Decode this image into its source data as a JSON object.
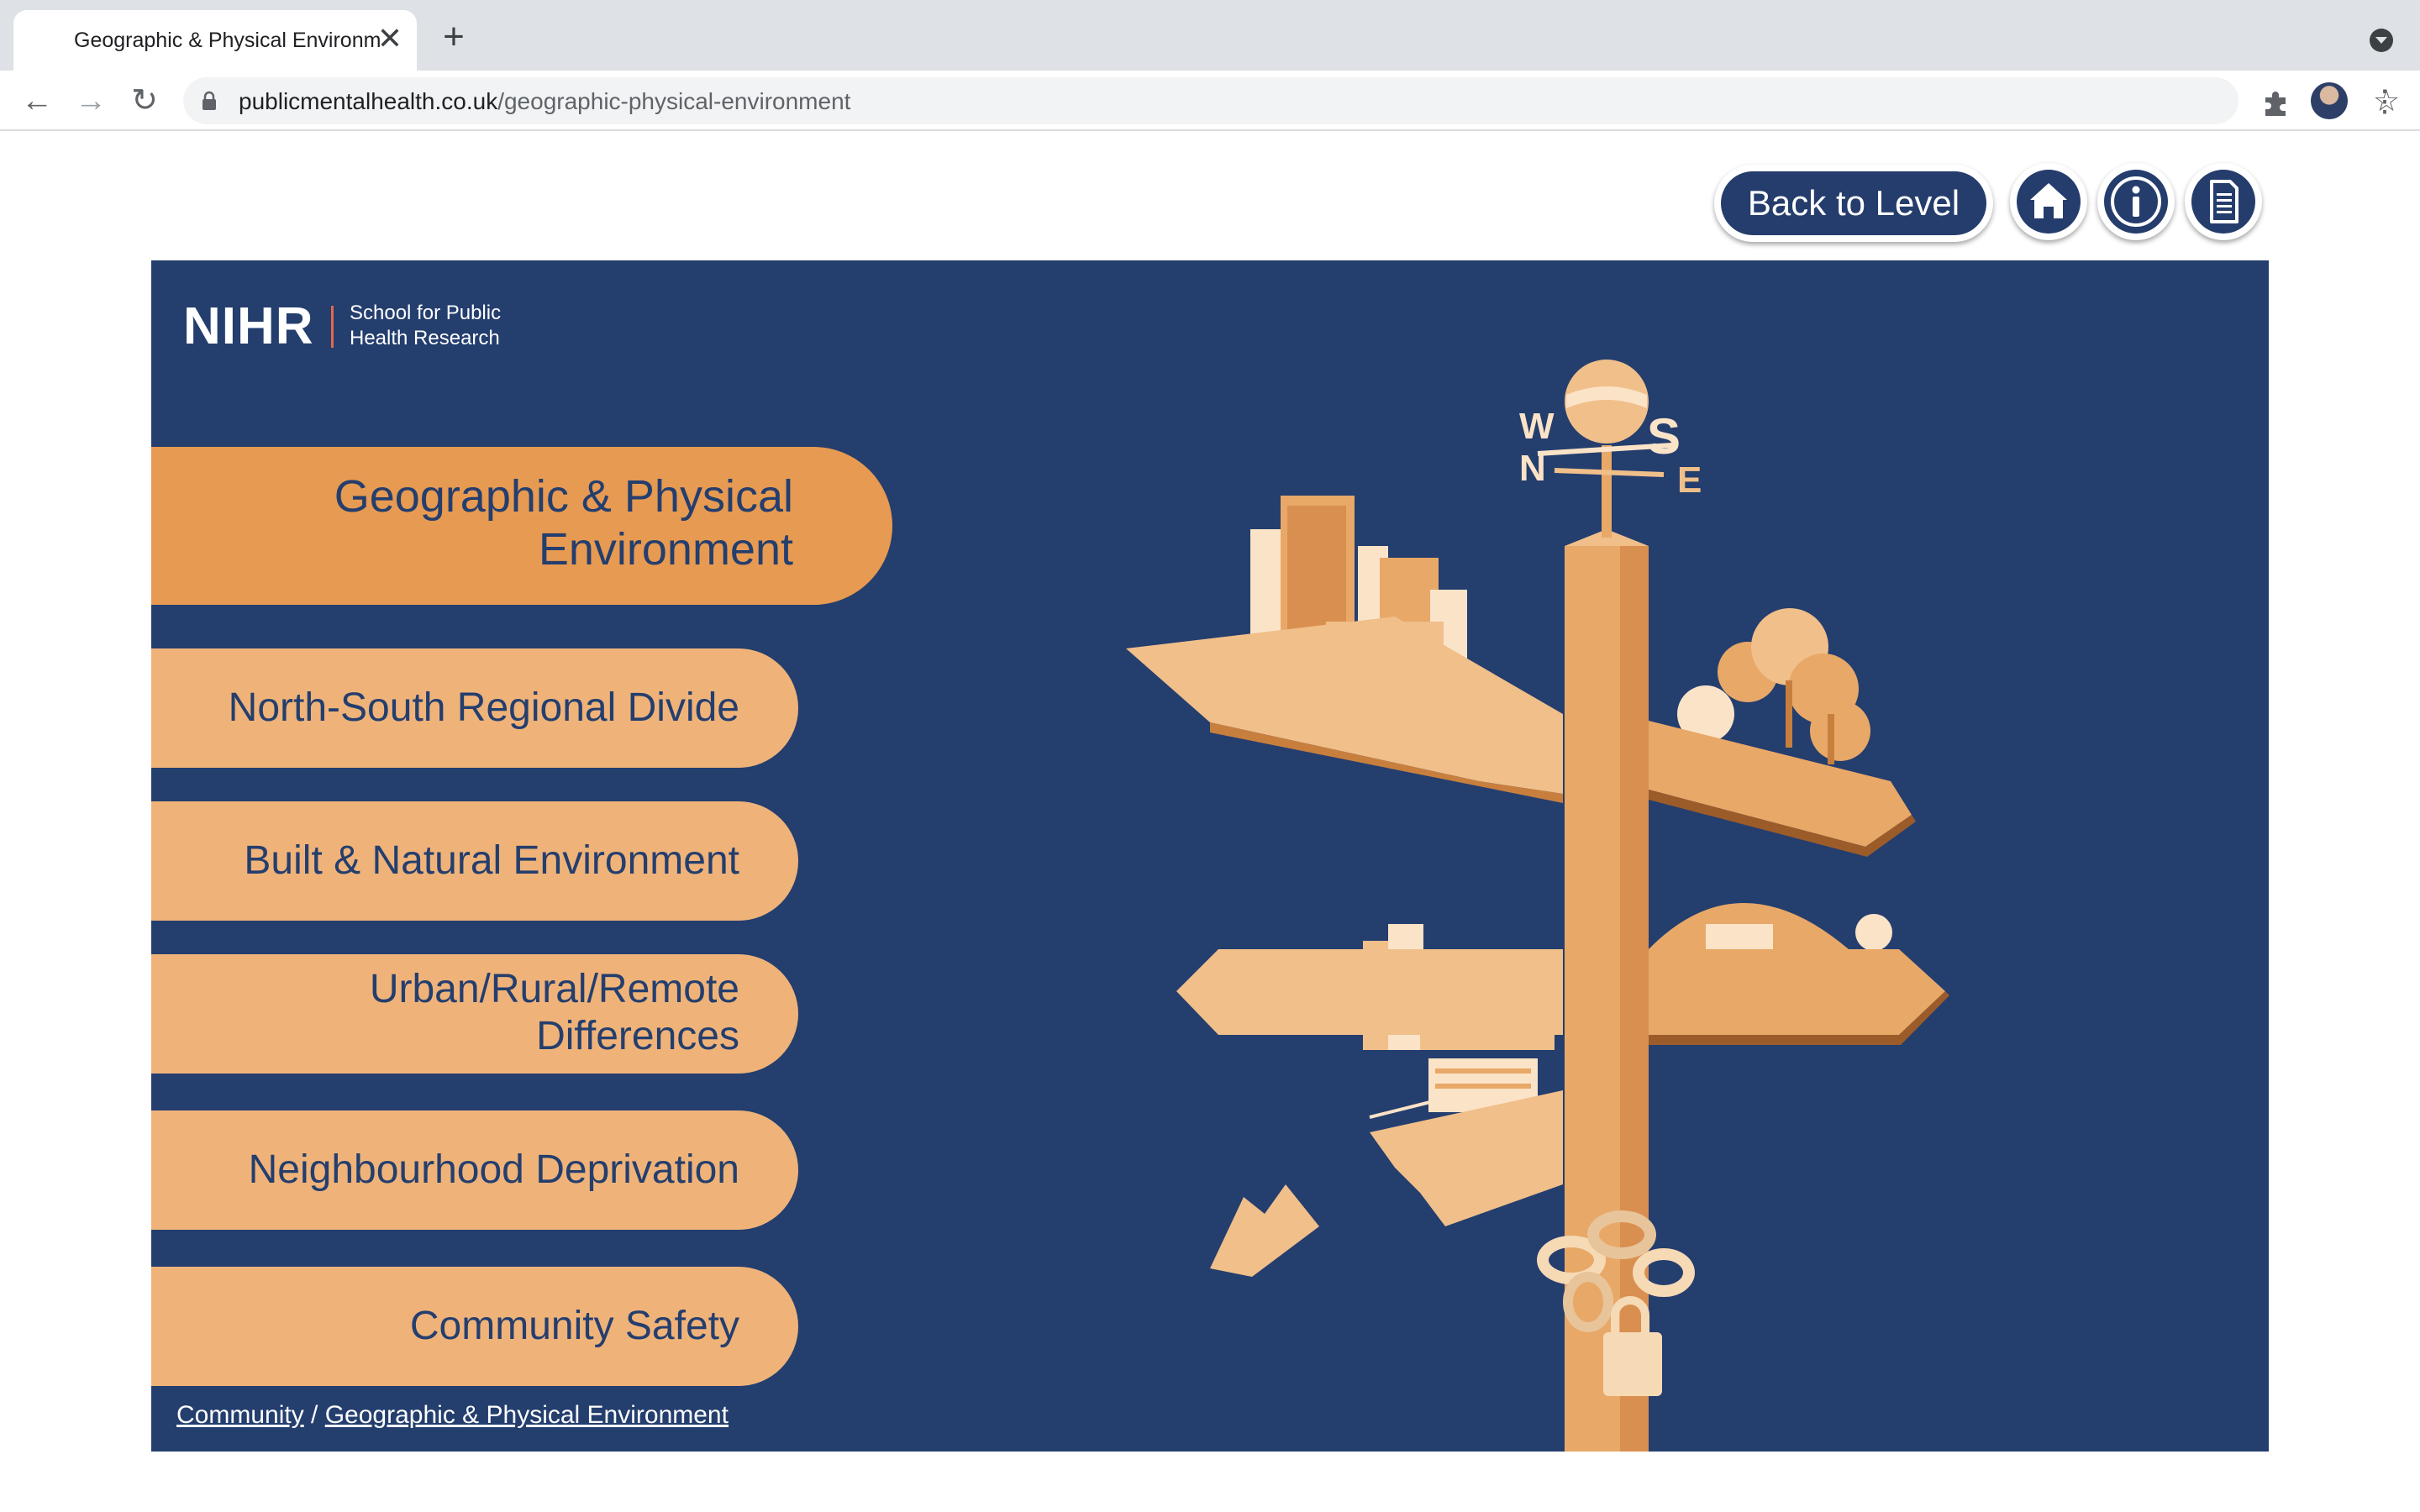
{
  "browser": {
    "tab_title": "Geographic & Physical Environm",
    "new_tab_icon": "+",
    "close_icon": "✕",
    "url_domain": "publicmentalhealth.co.uk",
    "url_path": "/geographic-physical-environment"
  },
  "header": {
    "back_label": "Back to Level",
    "home_icon": "home-icon",
    "info_icon": "info-icon",
    "document_icon": "document-icon"
  },
  "logo": {
    "name": "NIHR",
    "subtitle_line1": "School for Public",
    "subtitle_line2": "Health Research"
  },
  "menu": {
    "main_line1": "Geographic & Physical",
    "main_line2": "Environment",
    "items": [
      {
        "line1": "North-South Regional Divide",
        "line2": ""
      },
      {
        "line1": "Built & Natural Environment",
        "line2": ""
      },
      {
        "line1": "Urban/Rural/Remote",
        "line2": "Differences"
      },
      {
        "line1": "Neighbourhood Deprivation",
        "line2": ""
      },
      {
        "line1": "Community Safety",
        "line2": ""
      }
    ]
  },
  "breadcrumb": {
    "first": "Community",
    "separator": " / ",
    "second": "Geographic & Physical Environment"
  },
  "illustration": {
    "compass": {
      "west": "W",
      "north": "N",
      "south": "S",
      "east": "E"
    }
  },
  "colors": {
    "panel_bg": "#243e6e",
    "pill_active": "#e79a51",
    "pill": "#efb379",
    "pill_text": "#243e6e"
  }
}
